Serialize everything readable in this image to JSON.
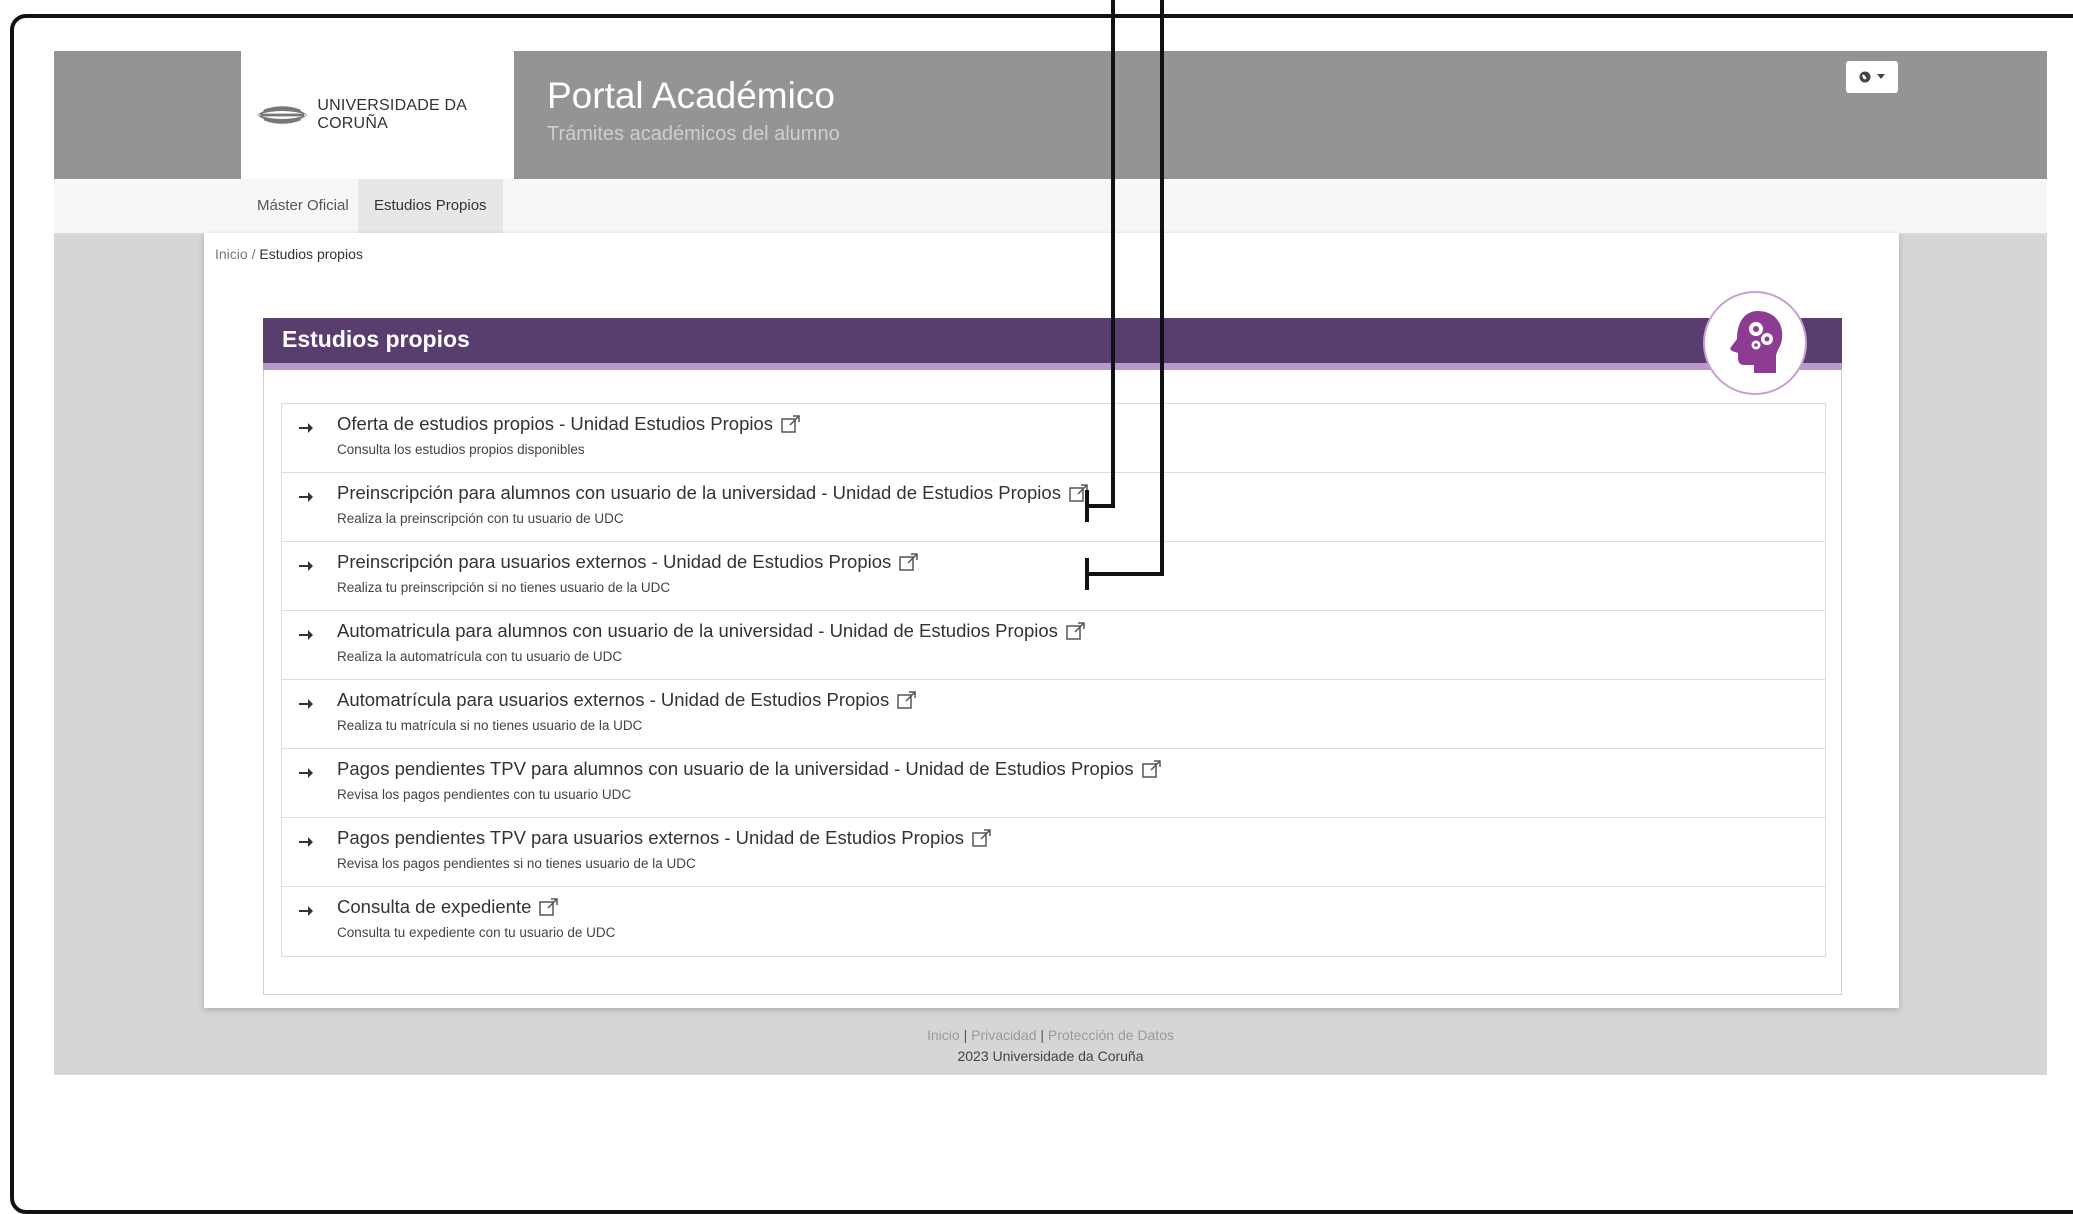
{
  "header": {
    "university": "UNIVERSIDADE DA CORUÑA",
    "title": "Portal Académico",
    "subtitle": "Trámites académicos del alumno",
    "language_icon": "globe-icon"
  },
  "nav": {
    "tabs": [
      {
        "label": "Máster Oficial",
        "active": false
      },
      {
        "label": "Estudios Propios",
        "active": true
      }
    ]
  },
  "breadcrumb": {
    "home": "Inicio",
    "separator": " / ",
    "current": "Estudios propios"
  },
  "panel": {
    "title": "Estudios propios",
    "header_color": "#583e6e",
    "accent_color": "#b69acb",
    "icon": "head-gears-icon",
    "items": [
      {
        "title": "Oferta de estudios propios - Unidad Estudios Propios",
        "description": "Consulta los estudios propios disponibles"
      },
      {
        "title": "Preinscripción para alumnos con usuario de la universidad - Unidad de Estudios Propios",
        "description": "Realiza la preinscripción con tu usuario de UDC"
      },
      {
        "title": "Preinscripción para usuarios externos - Unidad de Estudios Propios",
        "description": "Realiza tu preinscripción si no tienes usuario de la UDC"
      },
      {
        "title": "Automatricula para alumnos con usuario de la universidad - Unidad de Estudios Propios",
        "description": "Realiza la automatrícula con tu usuario de UDC"
      },
      {
        "title": "Automatrícula para usuarios externos - Unidad de Estudios Propios",
        "description": "Realiza tu matrícula si no tienes usuario de la UDC"
      },
      {
        "title": "Pagos pendientes TPV para alumnos con usuario de la universidad - Unidad de Estudios Propios",
        "description": "Revisa los pagos pendientes con tu usuario UDC"
      },
      {
        "title": "Pagos pendientes TPV para usuarios externos - Unidad de Estudios Propios",
        "description": "Revisa los pagos pendientes si no tienes usuario de la UDC"
      },
      {
        "title": "Consulta de expediente",
        "description": "Consulta tu expediente con tu usuario de UDC"
      }
    ]
  },
  "footer": {
    "links": [
      "Inicio",
      "Privacidad",
      "Protección de Datos"
    ],
    "separator": " | ",
    "copyright": "2023 Universidade da Coruña"
  }
}
